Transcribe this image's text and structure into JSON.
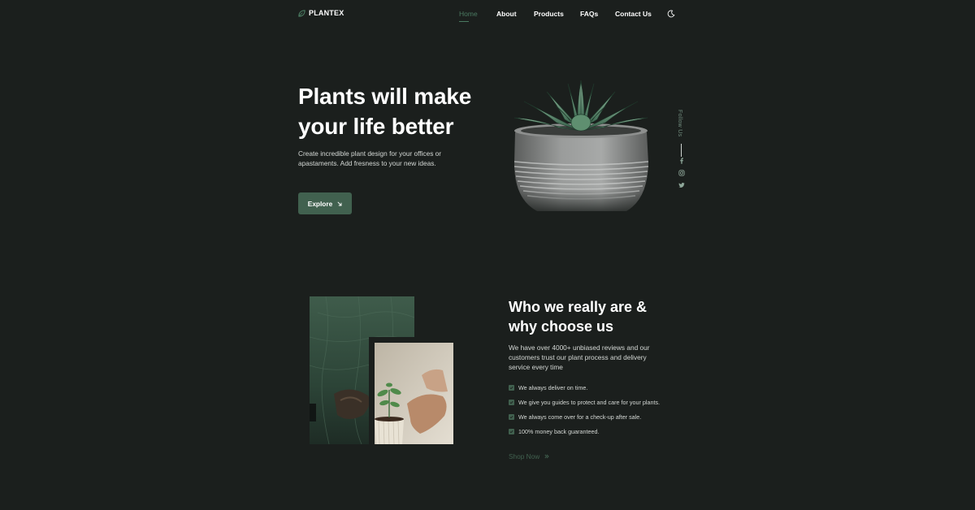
{
  "brand": {
    "name": "PLANTEX"
  },
  "nav": {
    "items": [
      {
        "label": "Home",
        "active": true
      },
      {
        "label": "About"
      },
      {
        "label": "Products"
      },
      {
        "label": "FAQs"
      },
      {
        "label": "Contact Us"
      }
    ],
    "theme_toggle_icon": "moon-icon"
  },
  "hero": {
    "title_line1": "Plants will make",
    "title_line2": "your life better",
    "description": "Create incredible plant design for your offices or apastaments. Add fresness to your new ideas.",
    "button_label": "Explore",
    "button_icon": "arrow-down-right-icon",
    "image": "succulent-in-pot"
  },
  "social": {
    "label": "Follow Us",
    "icons": [
      "facebook-icon",
      "instagram-icon",
      "twitter-icon"
    ]
  },
  "about": {
    "title_line1": "Who we really are &",
    "title_line2": "why choose us",
    "description": "We have over 4000+ unbiased reviews and our customers trust our plant process and delivery service every time",
    "checklist": [
      "We always deliver on time.",
      "We give you guides to protect and care for your plants.",
      "We always come over for a check-up after sale.",
      "100% money back guaranteed."
    ],
    "cta_label": "Shop Now",
    "cta_icon": "double-chevron-right-icon"
  },
  "colors": {
    "background": "#1b1f1d",
    "accent": "#41614f",
    "accent_text": "#4a7a61",
    "text": "#ffffff",
    "muted_text": "#d4d8d5"
  }
}
